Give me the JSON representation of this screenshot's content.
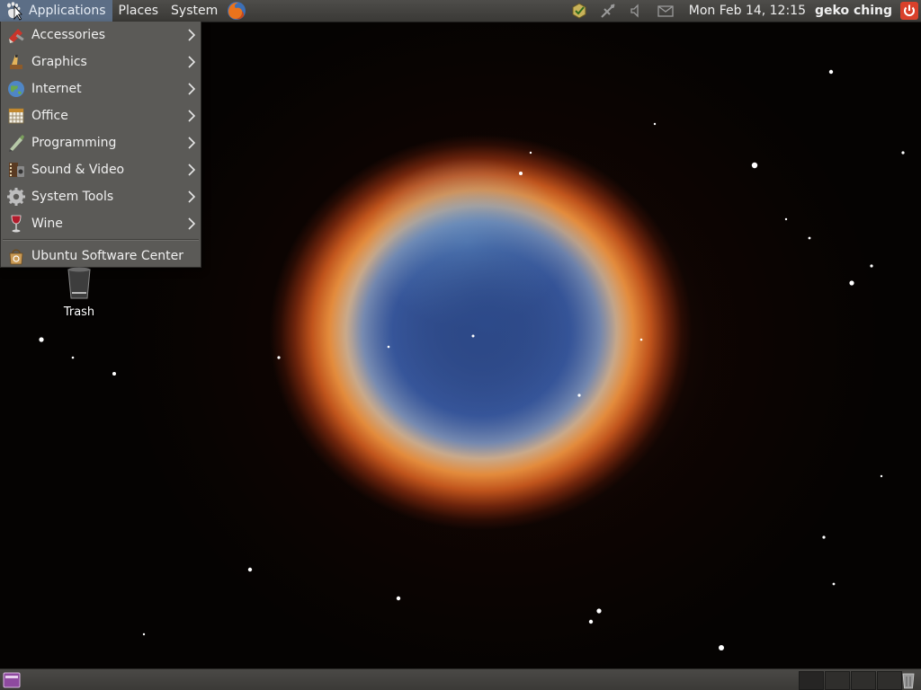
{
  "top_panel": {
    "menus": {
      "applications": "Applications",
      "places": "Places",
      "system": "System"
    },
    "clock": "Mon Feb 14, 12:15",
    "user": "geko ching"
  },
  "applications_menu": {
    "items": [
      {
        "label": "Accessories",
        "icon": "accessories-icon",
        "submenu": true
      },
      {
        "label": "Graphics",
        "icon": "graphics-icon",
        "submenu": true
      },
      {
        "label": "Internet",
        "icon": "internet-icon",
        "submenu": true
      },
      {
        "label": "Office",
        "icon": "office-icon",
        "submenu": true
      },
      {
        "label": "Programming",
        "icon": "programming-icon",
        "submenu": true
      },
      {
        "label": "Sound & Video",
        "icon": "sound-video-icon",
        "submenu": true
      },
      {
        "label": "System Tools",
        "icon": "system-tools-icon",
        "submenu": true
      },
      {
        "label": "Wine",
        "icon": "wine-icon",
        "submenu": true
      }
    ],
    "footer_item": {
      "label": "Ubuntu Software Center",
      "icon": "software-center-icon"
    }
  },
  "desktop": {
    "icons": [
      {
        "label": "Trash",
        "icon": "trash-icon"
      }
    ]
  },
  "bottom_panel": {
    "workspaces": 4,
    "active_workspace": 1
  },
  "colors": {
    "panel": "#3a3936",
    "menu_bg": "#5b5a57",
    "menu_highlight": "#5c6e86",
    "power": "#d9412b"
  }
}
